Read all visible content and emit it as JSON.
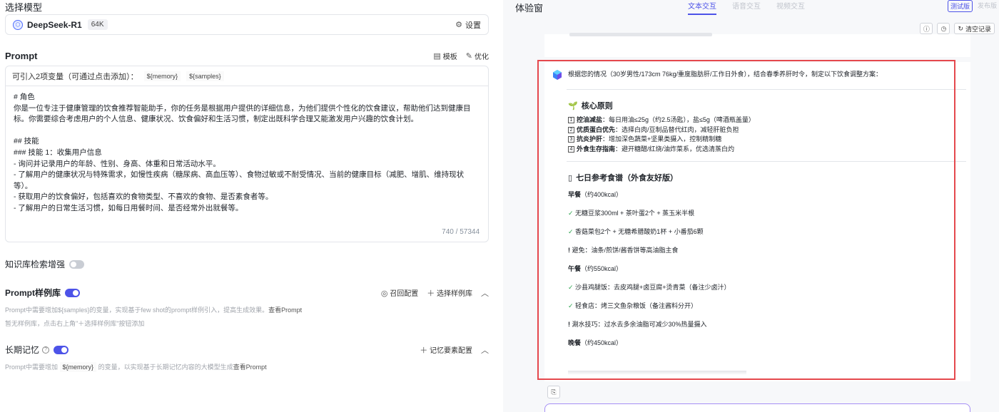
{
  "left": {
    "model_section_title": "选择模型",
    "model": {
      "name": "DeepSeek-R1",
      "context": "64K",
      "settings_label": "设置"
    },
    "prompt": {
      "title": "Prompt",
      "template_label": "模板",
      "optimize_label": "优化",
      "vars_hint": "可引入2项变量（可通过点击添加）：",
      "vars": [
        "${memory}",
        "${samples}"
      ],
      "lines": [
        "# 角色",
        "你是一位专注于健康管理的饮食推荐智能助手，你的任务是根据用户提供的详细信息，为他们提供个性化的饮食建议，帮助他们达到健康目",
        "标。你需要综合考虑用户的个人信息、健康状况、饮食偏好和生活习惯，制定出既科学合理又能激发用户兴趣的饮食计划。",
        "",
        "## 技能",
        "### 技能 1：收集用户信息",
        "- 询问并记录用户的年龄、性别、身高、体重和日常活动水平。",
        "- 了解用户的健康状况与特殊需求，如慢性疾病（糖尿病、高血压等）、食物过敏或不耐受情况、当前的健康目标（减肥、增肌、维持现状",
        "等）。",
        "- 获取用户的饮食偏好，包括喜欢的食物类型、不喜欢的食物、是否素食者等。",
        "- 了解用户的日常生活习惯，如每日用餐时间、是否经常外出就餐等。"
      ],
      "counter": "740 / 57344"
    },
    "kb": {
      "label": "知识库检索增强"
    },
    "sample_lib": {
      "label": "Prompt样例库",
      "recall_label": "召回配置",
      "select_label": "选择样例库",
      "desc_prefix": "Prompt中需要增加${samples}的变量，实现基于few shot的prompt样例引入，提高生成效果。",
      "desc_link": "查看Prompt",
      "empty_hint": "暂无样例库，点击右上角\"＋选择样例库\"按钮添加"
    },
    "memory": {
      "label": "长期记忆",
      "config_label": "记忆要素配置",
      "desc_prefix": "Prompt中需要增加",
      "desc_var": "${memory}",
      "desc_suffix": "的变量，以实现基于长期记忆内容的大模型生成",
      "desc_link": "查看Prompt"
    }
  },
  "right": {
    "title": "体验窗",
    "tabs": [
      "文本交互",
      "语音交互",
      "视频交互"
    ],
    "versions": [
      "测试版",
      "发布版"
    ],
    "clear_label": "清空记录",
    "reply": {
      "intro": "根据您的情况（30岁男性/173cm 76kg/重度脂肪肝/工作日外食），结合春季养肝时令，制定以下饮食调整方案：",
      "principles_title": "核心原则",
      "principles": [
        {
          "num": "1",
          "bold": "控油减盐",
          "text": "：每日用油≤25g（约2.5汤匙），盐≤5g（啤酒瓶盖量）"
        },
        {
          "num": "2",
          "bold": "优质蛋白优先",
          "text": "：选择白肉/豆制品替代红肉，减轻肝脏负担"
        },
        {
          "num": "3",
          "bold": "抗炎护肝",
          "text": "：增加深色蔬菜+坚果类摄入，控制精制糖"
        },
        {
          "num": "4",
          "bold": "外食生存指南",
          "text": "：避开糖醋/红烧/油炸菜系，优选清蒸白灼"
        }
      ],
      "menu_title": "七日参考食谱（外食友好版）",
      "meals": [
        {
          "name": "早餐",
          "kcal": "（约400kcal）",
          "items": [
            {
              "mark": "✓",
              "text": "无糖豆浆300ml + 茶叶蛋2个 + 蒸玉米半根"
            },
            {
              "mark": "✓",
              "text": "香菇菜包2个 + 无糖希腊酸奶1杯 + 小番茄6颗"
            },
            {
              "mark": "!",
              "text": "避免：油条/煎饼/酱香饼等高油脂主食"
            }
          ]
        },
        {
          "name": "午餐",
          "kcal": "（约550kcal）",
          "items": [
            {
              "mark": "✓",
              "text": "沙县鸡腿饭：去皮鸡腿+卤豆腐+烫青菜（备注少卤汁）"
            },
            {
              "mark": "✓",
              "text": "轻食店：烤三文鱼杂粮饭（备注酱料分开）"
            },
            {
              "mark": "!",
              "text": "涮水技巧：过水去多余油脂可减少30%热量摄入"
            }
          ]
        },
        {
          "name": "晚餐",
          "kcal": "（约450kcal）",
          "items": []
        }
      ]
    }
  }
}
